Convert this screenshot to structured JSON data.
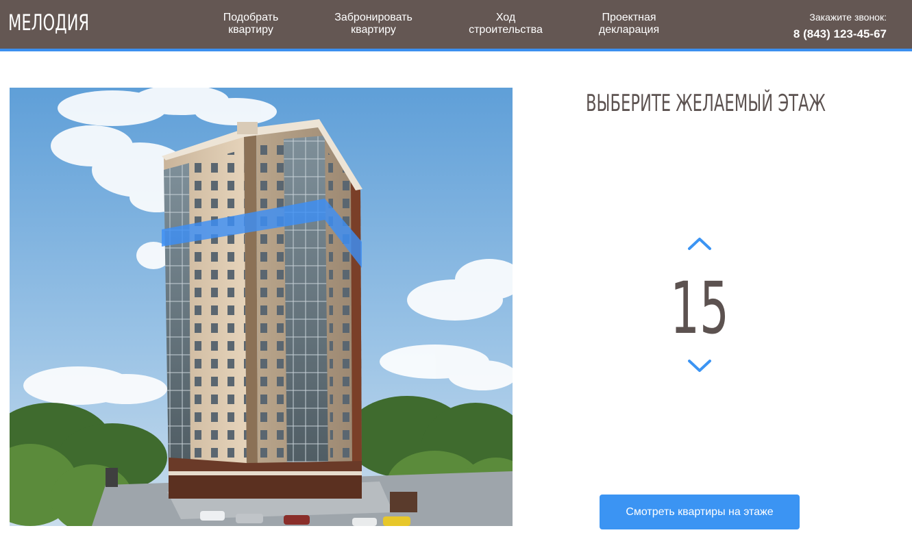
{
  "header": {
    "logo": "МЕЛОДИЯ",
    "nav": [
      {
        "line1": "Подобрать",
        "line2": "квартиру"
      },
      {
        "line1": "Забронировать",
        "line2": "квартиру"
      },
      {
        "line1": "Ход",
        "line2": "строительства"
      },
      {
        "line1": "Проектная",
        "line2": "декларация"
      }
    ],
    "call_label": "Закажите звонок:",
    "phone": "8 (843) 123-45-67"
  },
  "floor_selector": {
    "title": "ВЫБЕРИТЕ ЖЕЛАЕМЫЙ ЭТАЖ",
    "floor": "15",
    "button_label": "Смотреть квартиры на этаже"
  },
  "colors": {
    "header_bg": "#645753",
    "accent": "#3b8ff0",
    "text": "#5c5250",
    "highlight": "#3d8ff5"
  },
  "icons": {
    "up": "chevron-up-icon",
    "down": "chevron-down-icon"
  }
}
